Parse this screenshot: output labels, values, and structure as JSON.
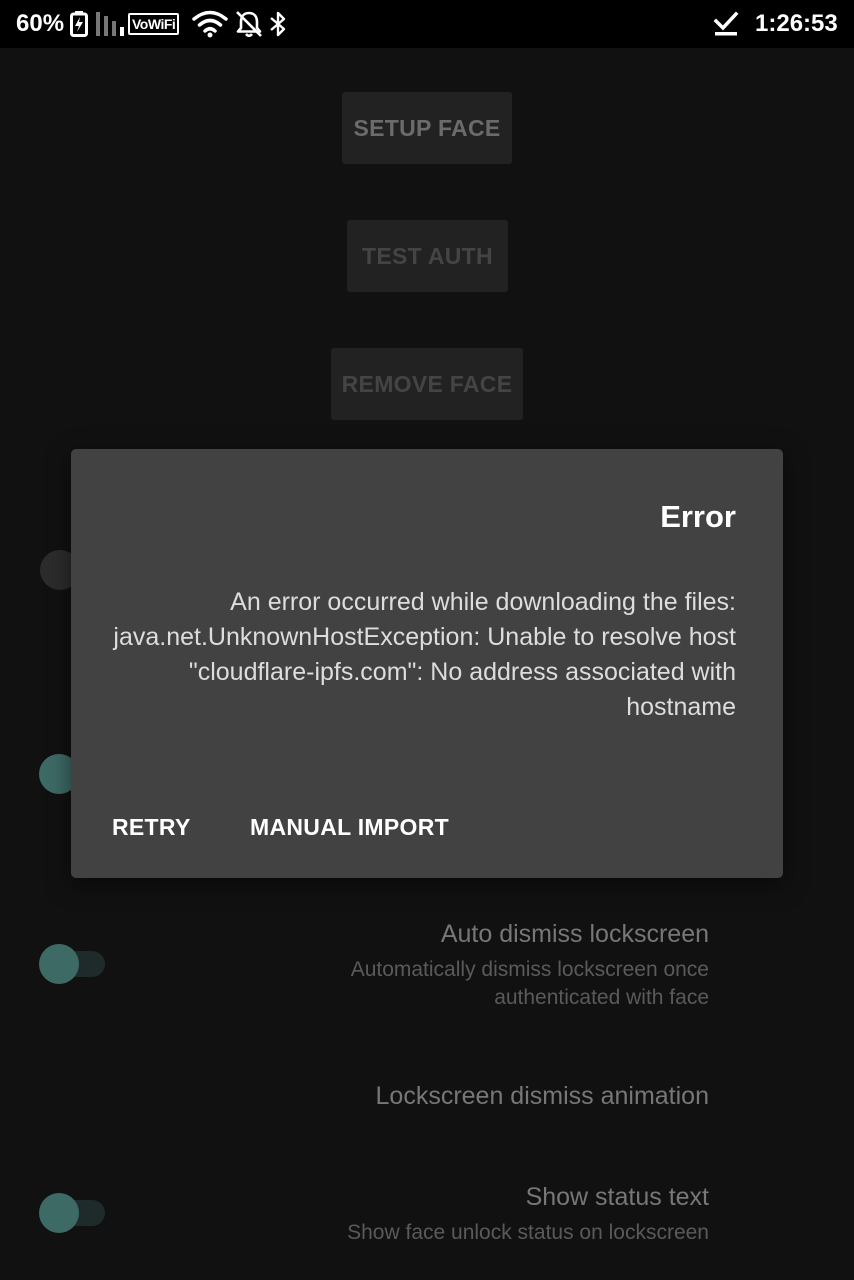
{
  "status_bar": {
    "battery_percent": "60%",
    "network_label": "VoWiFi",
    "time": "1:26:53"
  },
  "buttons": {
    "setup_face": "SETUP FACE",
    "test_auth": "TEST AUTH",
    "remove_face": "REMOVE FACE"
  },
  "preferences": [
    {
      "title": "Auto dismiss lockscreen",
      "summary_lines": [
        "Automatically dismiss lockscreen once",
        "authenticated with face"
      ],
      "switch_on": true
    },
    {
      "title": "Lockscreen dismiss animation"
    },
    {
      "title": "Show status text",
      "summary_lines": [
        "Show face unlock status on lockscreen"
      ],
      "switch_on": true
    }
  ],
  "dialog": {
    "title": "Error",
    "message": "An error occurred while downloading the files: java.net.UnknownHostException: Unable to resolve host \"cloudflare-ipfs.com\": No address associated with hostname",
    "actions": {
      "retry": "RETRY",
      "manual_import": "MANUAL IMPORT"
    }
  },
  "colors": {
    "background": "#111111",
    "dialog": "#424242",
    "switch_thumb_on": "#3e6a66"
  }
}
